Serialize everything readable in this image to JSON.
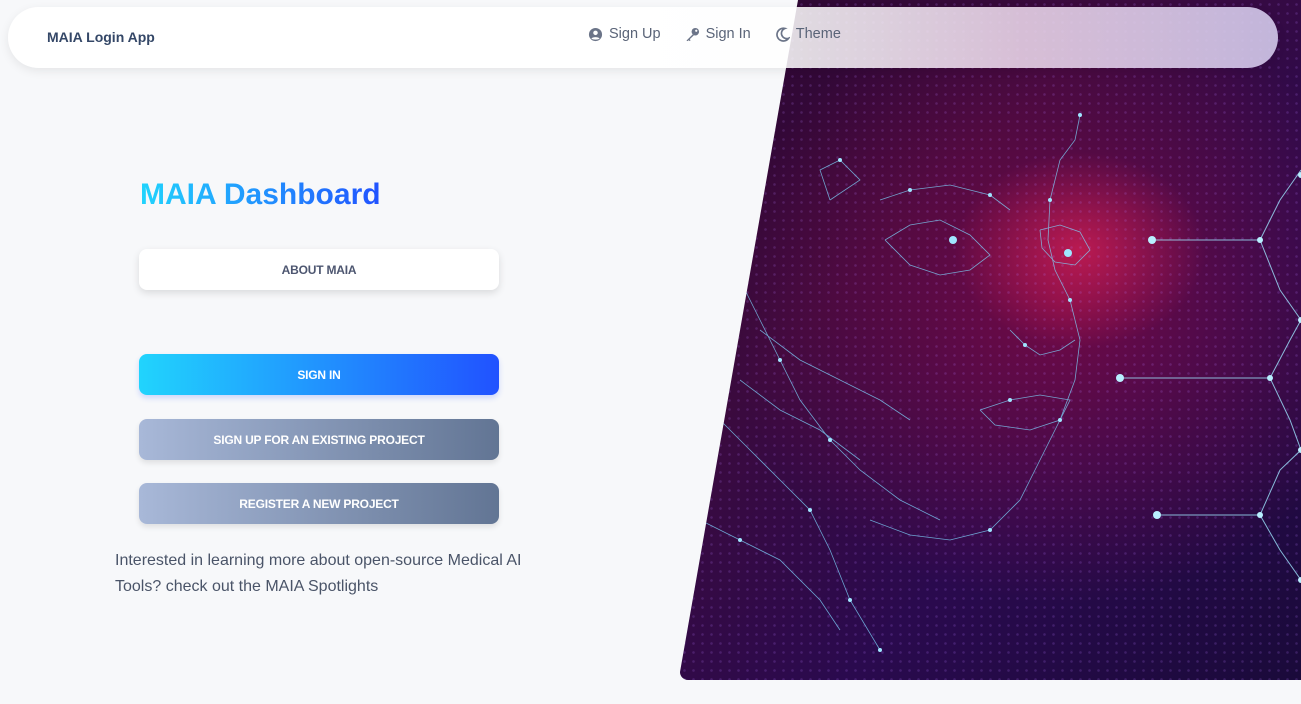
{
  "navbar": {
    "brand": "MAIA Login App",
    "links": [
      {
        "label": "Sign Up",
        "icon": "user-circle-icon"
      },
      {
        "label": "Sign In",
        "icon": "key-icon"
      },
      {
        "label": "Theme",
        "icon": "moon-icon"
      }
    ]
  },
  "main": {
    "title": "MAIA Dashboard",
    "about_button": "ABOUT MAIA",
    "signin_button": "SIGN IN",
    "signup_button": "SIGN UP FOR AN EXISTING PROJECT",
    "register_button": "REGISTER A NEW PROJECT",
    "info_text": "Interested in learning more about open-source Medical AI Tools? check out the MAIA Spotlights"
  },
  "colors": {
    "accent_start": "#21d4fd",
    "accent_end": "#2152ff",
    "secondary_start": "#a8b8d8",
    "secondary_end": "#627594",
    "text": "#344767"
  },
  "hero": {
    "image_description_icon": "ai-face-network-image"
  }
}
